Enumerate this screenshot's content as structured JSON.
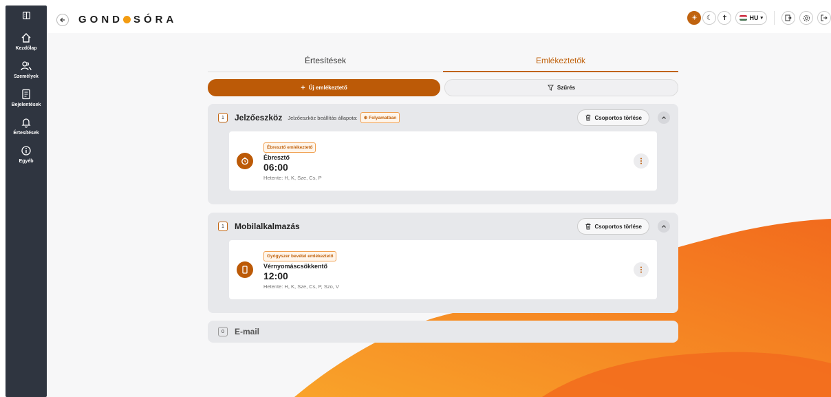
{
  "sidebar": {
    "items": [
      {
        "label": "Kezdőlap",
        "icon": "home-icon"
      },
      {
        "label": "Személyek",
        "icon": "users-icon"
      },
      {
        "label": "Bejelentések",
        "icon": "document-icon"
      },
      {
        "label": "Értesítések",
        "icon": "bell-icon"
      },
      {
        "label": "Egyéb",
        "icon": "info-icon"
      }
    ]
  },
  "header": {
    "logo_left": "GOND",
    "logo_right": "SÓRA",
    "language": "HU"
  },
  "tabs": [
    {
      "label": "Értesítések",
      "active": false
    },
    {
      "label": "Emlékeztetők",
      "active": true
    }
  ],
  "actions": {
    "new_label": "Új emlékeztető",
    "filter_label": "Szűrés"
  },
  "groups": [
    {
      "count": "1",
      "title": "Jelzőeszköz",
      "subtitle": "Jelzőeszköz beállítás állapota:",
      "status": "Folyamatban",
      "delete_label": "Csoportos törlése",
      "card": {
        "type": "Ébresztő emlékeztető",
        "name": "Ébresztő",
        "time": "06:00",
        "days": "Hetente: H, K, Sze, Cs, P"
      }
    },
    {
      "count": "1",
      "title": "Mobilalkalmazás",
      "delete_label": "Csoportos törlése",
      "card": {
        "type": "Gyógyszer bevétel emlékeztető",
        "name": "Vérnyomáscsökkentő",
        "time": "12:00",
        "days": "Hetente: H, K, Sze, Cs, P, Szo, V"
      }
    },
    {
      "count": "0",
      "title": "E-mail"
    }
  ],
  "colors": {
    "accent": "#bc5a07",
    "sidebar": "#2f3540",
    "wave": "#f58a1f"
  }
}
